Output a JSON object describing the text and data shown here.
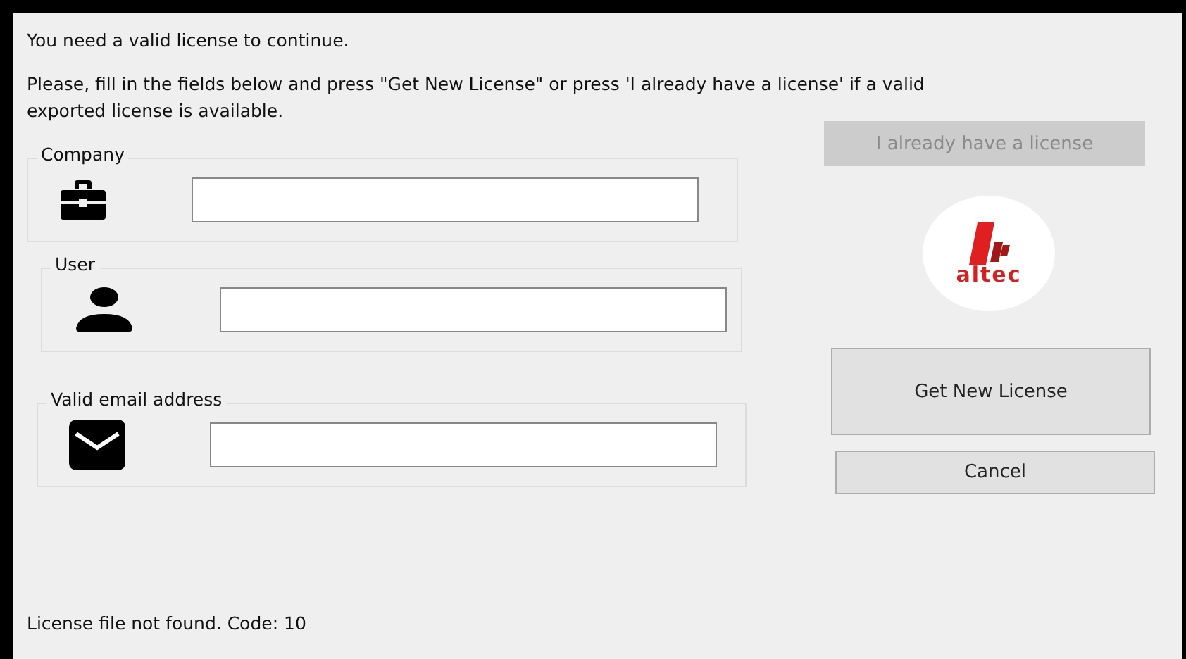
{
  "intro": "You need a valid license to continue.",
  "instructions": "Please, fill in the fields below and press \"Get New License\" or press 'I already have a license' if  a valid exported license is available.",
  "fields": [
    {
      "kind": "company",
      "label": "Company"
    },
    {
      "kind": "user",
      "label": "User"
    },
    {
      "kind": "email",
      "label": "Valid email address"
    }
  ],
  "already_button": {
    "label": "I already have a license",
    "disabled": true
  },
  "logo": {
    "text": "altec"
  },
  "get_button": {
    "label": "Get New License",
    "disabled": false
  },
  "cancel_button": {
    "label": "Cancel",
    "disabled": false
  },
  "status": "License file not found. Code: 10"
}
